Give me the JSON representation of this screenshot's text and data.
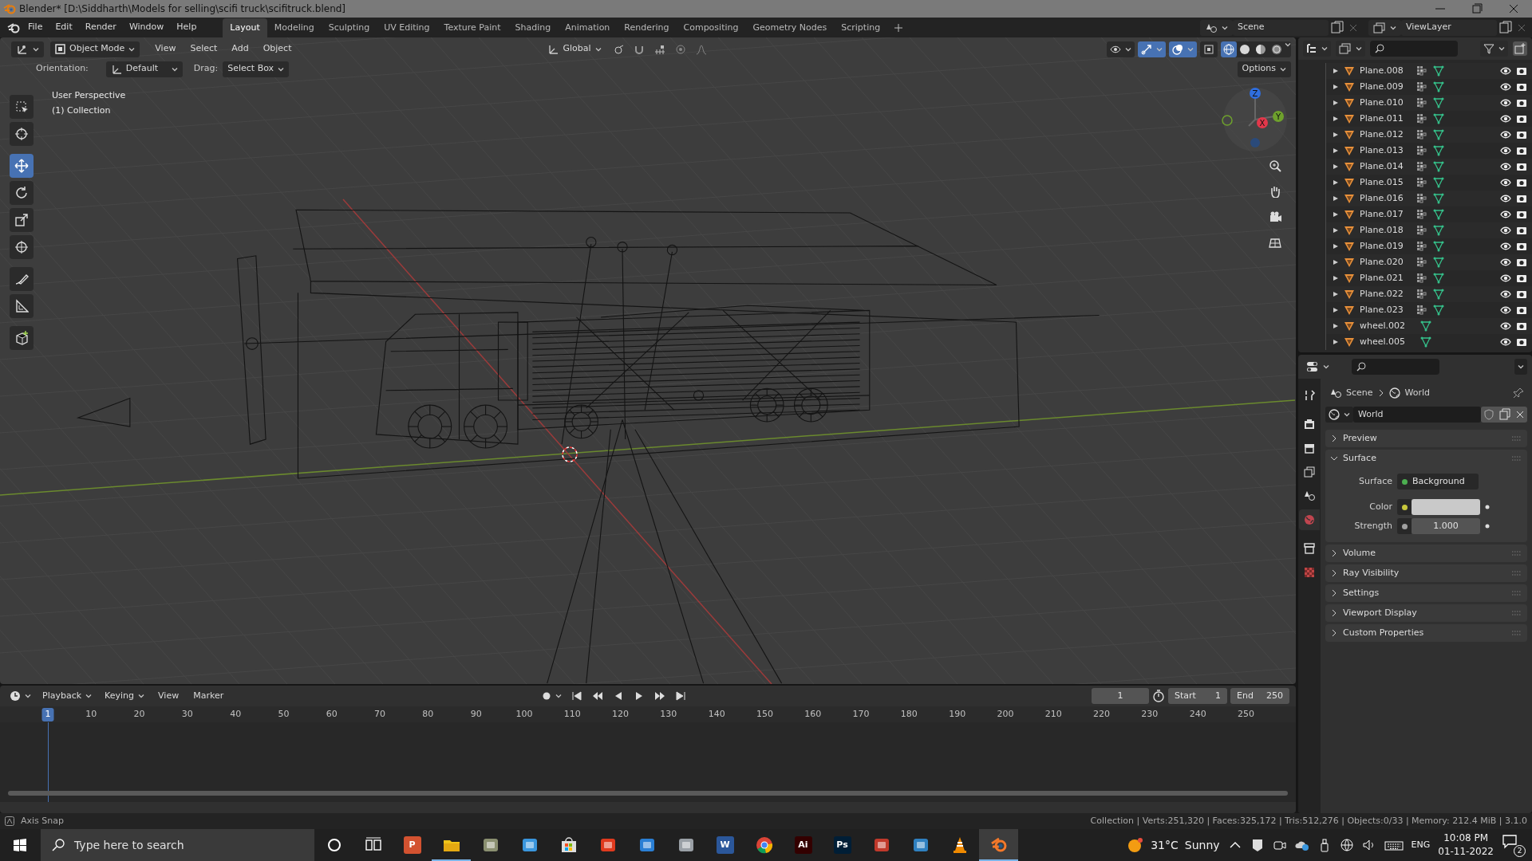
{
  "window": {
    "title": "Blender* [D:\\Siddharth\\Models for selling\\scifi truck\\scifitruck.blend]"
  },
  "menu": [
    "File",
    "Edit",
    "Render",
    "Window",
    "Help"
  ],
  "workspaces": [
    {
      "label": "Layout",
      "selected": true
    },
    {
      "label": "Modeling",
      "selected": false
    },
    {
      "label": "Sculpting",
      "selected": false
    },
    {
      "label": "UV Editing",
      "selected": false
    },
    {
      "label": "Texture Paint",
      "selected": false
    },
    {
      "label": "Shading",
      "selected": false
    },
    {
      "label": "Animation",
      "selected": false
    },
    {
      "label": "Rendering",
      "selected": false
    },
    {
      "label": "Compositing",
      "selected": false
    },
    {
      "label": "Geometry Nodes",
      "selected": false
    },
    {
      "label": "Scripting",
      "selected": false
    }
  ],
  "scene": {
    "name": "Scene"
  },
  "view_layer": {
    "name": "ViewLayer"
  },
  "viewport": {
    "mode": "Object Mode",
    "menus": [
      "View",
      "Select",
      "Add",
      "Object"
    ],
    "transform": "Global",
    "orientation_label": "Orientation:",
    "orientation": "Default",
    "drag_label": "Drag:",
    "drag": "Select Box",
    "options": "Options",
    "info": [
      "User Perspective",
      "(1) Collection"
    ],
    "tools": [
      {
        "kind": "select",
        "selected": false
      },
      {
        "kind": "cursor",
        "selected": false
      },
      {
        "kind": "move",
        "selected": true
      },
      {
        "kind": "rotate",
        "selected": false
      },
      {
        "kind": "scale",
        "selected": false
      },
      {
        "kind": "transform",
        "selected": false
      },
      {
        "kind": "annotate",
        "selected": false
      },
      {
        "kind": "measure",
        "selected": false
      },
      {
        "kind": "add-cube",
        "selected": false
      }
    ],
    "gizmo": {
      "axes": [
        "Z",
        "Y",
        "X"
      ]
    },
    "shading": [
      {
        "kind": "wireframe",
        "selected": true
      },
      {
        "kind": "solid",
        "selected": false
      },
      {
        "kind": "material",
        "selected": false
      },
      {
        "kind": "rendered",
        "selected": false
      }
    ]
  },
  "outliner": {
    "items": [
      {
        "name": "Plane.008",
        "modifiers": true
      },
      {
        "name": "Plane.009",
        "modifiers": true
      },
      {
        "name": "Plane.010",
        "modifiers": true
      },
      {
        "name": "Plane.011",
        "modifiers": true
      },
      {
        "name": "Plane.012",
        "modifiers": true
      },
      {
        "name": "Plane.013",
        "modifiers": true
      },
      {
        "name": "Plane.014",
        "modifiers": true
      },
      {
        "name": "Plane.015",
        "modifiers": true
      },
      {
        "name": "Plane.016",
        "modifiers": true
      },
      {
        "name": "Plane.017",
        "modifiers": true
      },
      {
        "name": "Plane.018",
        "modifiers": true
      },
      {
        "name": "Plane.019",
        "modifiers": true
      },
      {
        "name": "Plane.020",
        "modifiers": true
      },
      {
        "name": "Plane.021",
        "modifiers": true
      },
      {
        "name": "Plane.022",
        "modifiers": true
      },
      {
        "name": "Plane.023",
        "modifiers": true
      },
      {
        "name": "wheel.002",
        "modifiers": false
      },
      {
        "name": "wheel.005",
        "modifiers": false
      }
    ]
  },
  "properties": {
    "tabs": [
      {
        "kind": "tool",
        "selected": false
      },
      {
        "kind": "render",
        "selected": false
      },
      {
        "kind": "output",
        "selected": false
      },
      {
        "kind": "view-layer",
        "selected": false
      },
      {
        "kind": "scene",
        "selected": false
      },
      {
        "kind": "world",
        "selected": true
      },
      {
        "kind": "collection",
        "selected": false
      },
      {
        "kind": "texture",
        "selected": false
      }
    ],
    "breadcrumb": [
      "Scene",
      "World"
    ],
    "world": "World",
    "panels": [
      {
        "label": "Preview",
        "expanded": false
      },
      {
        "label": "Surface",
        "expanded": true,
        "fields": [
          {
            "kind": "shader",
            "label": "Surface",
            "value": "Background",
            "color": "#4caf50"
          },
          {
            "kind": "color",
            "label": "Color",
            "color": "#c8c83c"
          },
          {
            "kind": "number",
            "label": "Strength",
            "value": "1.000",
            "color": "#a0a0a0"
          }
        ]
      },
      {
        "label": "Volume",
        "expanded": false
      },
      {
        "label": "Ray Visibility",
        "expanded": false
      },
      {
        "label": "Settings",
        "expanded": false
      },
      {
        "label": "Viewport Display",
        "expanded": false
      },
      {
        "label": "Custom Properties",
        "expanded": false
      }
    ]
  },
  "timeline": {
    "menus": [
      "Playback",
      "Keying",
      "View",
      "Marker"
    ],
    "current_frame": "1",
    "start_label": "Start",
    "start": "1",
    "end_label": "End",
    "end": "250",
    "ruler": [
      {
        "label": "1",
        "selected": true
      },
      {
        "label": "10",
        "selected": false
      },
      {
        "label": "20",
        "selected": false
      },
      {
        "label": "30",
        "selected": false
      },
      {
        "label": "40",
        "selected": false
      },
      {
        "label": "50",
        "selected": false
      },
      {
        "label": "60",
        "selected": false
      },
      {
        "label": "70",
        "selected": false
      },
      {
        "label": "80",
        "selected": false
      },
      {
        "label": "90",
        "selected": false
      },
      {
        "label": "100",
        "selected": false
      },
      {
        "label": "110",
        "selected": false
      },
      {
        "label": "120",
        "selected": false
      },
      {
        "label": "130",
        "selected": false
      },
      {
        "label": "140",
        "selected": false
      },
      {
        "label": "150",
        "selected": false
      },
      {
        "label": "160",
        "selected": false
      },
      {
        "label": "170",
        "selected": false
      },
      {
        "label": "180",
        "selected": false
      },
      {
        "label": "190",
        "selected": false
      },
      {
        "label": "200",
        "selected": false
      },
      {
        "label": "210",
        "selected": false
      },
      {
        "label": "220",
        "selected": false
      },
      {
        "label": "230",
        "selected": false
      },
      {
        "label": "240",
        "selected": false
      },
      {
        "label": "250",
        "selected": false
      }
    ]
  },
  "status_bar": {
    "hint": "Axis Snap",
    "stats": "Collection | Verts:251,320 | Faces:325,172 | Tris:512,276 | Objects:0/33 | Memory: 212.4 MiB | 3.1.0"
  },
  "taskbar": {
    "search_placeholder": "Type here to search",
    "apps": [
      {
        "kind": "cortana",
        "selected": false,
        "running": false
      },
      {
        "kind": "task-view",
        "selected": false,
        "running": false
      },
      {
        "kind": "letter",
        "label": "P",
        "color": "#d35230",
        "selected": false,
        "running": false
      },
      {
        "kind": "folder",
        "selected": false,
        "running": true
      },
      {
        "kind": "generic",
        "color": "#8a8f70",
        "selected": false,
        "running": false
      },
      {
        "kind": "generic",
        "color": "#3a96dd",
        "selected": false,
        "running": false
      },
      {
        "kind": "store",
        "selected": false,
        "running": false
      },
      {
        "kind": "generic",
        "color": "#e03a1e",
        "selected": false,
        "running": false
      },
      {
        "kind": "generic",
        "color": "#2a7fd4",
        "selected": false,
        "running": false
      },
      {
        "kind": "generic",
        "color": "#9aa0a6",
        "selected": false,
        "running": false
      },
      {
        "kind": "letter",
        "label": "W",
        "color": "#2b579a",
        "selected": false,
        "running": false
      },
      {
        "kind": "chrome",
        "selected": false,
        "running": false
      },
      {
        "kind": "letter",
        "label": "Ai",
        "color": "#330000",
        "selected": false,
        "running": false
      },
      {
        "kind": "letter",
        "label": "Ps",
        "color": "#001e36",
        "selected": false,
        "running": false
      },
      {
        "kind": "generic",
        "color": "#c0392b",
        "selected": false,
        "running": false
      },
      {
        "kind": "generic",
        "color": "#2f80c0",
        "selected": false,
        "running": false
      },
      {
        "kind": "cone",
        "selected": false,
        "running": false
      },
      {
        "kind": "blender",
        "selected": true,
        "running": true
      }
    ],
    "weather": {
      "temperature": "31°C",
      "condition": "Sunny"
    },
    "language": "ENG",
    "time": "10:08 PM",
    "date": "01-11-2022",
    "notifications": "2"
  }
}
